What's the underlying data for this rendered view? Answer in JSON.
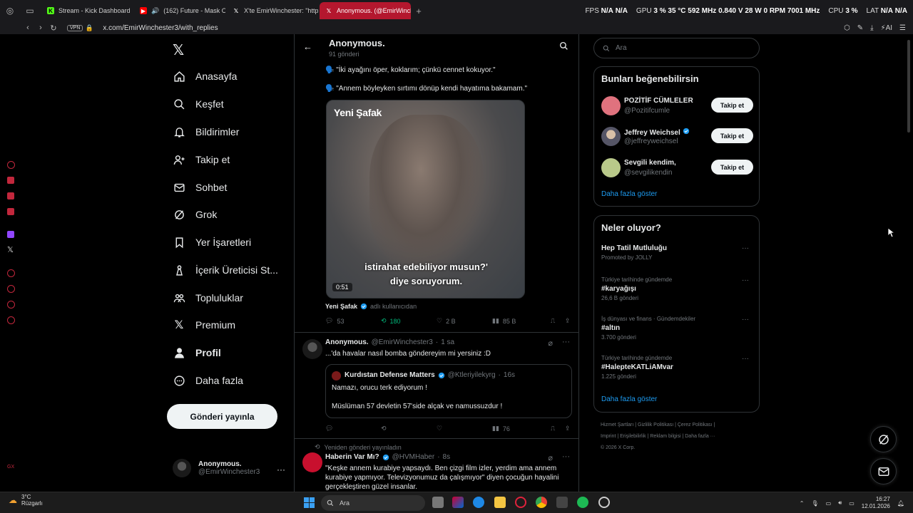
{
  "browser": {
    "tabs": [
      {
        "label": "Stream - Kick Dashboard",
        "active": false
      },
      {
        "label": "(162) Future - Mask Of",
        "active": false
      },
      {
        "label": "X'te EmirWinchester: \"http",
        "active": false
      },
      {
        "label": "Anonymous. (@EmirWinch",
        "active": true
      }
    ],
    "url": "x.com/EmirWinchester3/with_replies",
    "vpn_label": "VPN",
    "hud": {
      "fps_label": "FPS",
      "fps_1": "N/A",
      "fps_2": "N/A",
      "gpu_label": "GPU",
      "gpu_load": "3 %",
      "gpu_temp": "35 °C",
      "gpu_clock": "592 MHz",
      "gpu_voltage": "0.840 V",
      "gpu_power": "28 W",
      "gpu_rpm": "0 RPM",
      "gpu_mem": "7001 MHz",
      "cpu_label": "CPU",
      "cpu_load": "3 %",
      "lat_label": "LAT",
      "lat_1": "N/A",
      "lat_2": "N/A"
    },
    "ai_label": "AI"
  },
  "nav": {
    "items": [
      {
        "label": "Anasayfa",
        "icon": "home-icon"
      },
      {
        "label": "Keşfet",
        "icon": "search-icon"
      },
      {
        "label": "Bildirimler",
        "icon": "bell-icon"
      },
      {
        "label": "Takip et",
        "icon": "follow-icon"
      },
      {
        "label": "Sohbet",
        "icon": "mail-icon"
      },
      {
        "label": "Grok",
        "icon": "grok-icon"
      },
      {
        "label": "Yer İşaretleri",
        "icon": "bookmark-icon"
      },
      {
        "label": "İçerik Üreticisi St...",
        "icon": "creator-icon"
      },
      {
        "label": "Topluluklar",
        "icon": "communities-icon"
      },
      {
        "label": "Premium",
        "icon": "x-icon"
      },
      {
        "label": "Profil",
        "icon": "profile-icon"
      },
      {
        "label": "Daha fazla",
        "icon": "more-icon"
      }
    ],
    "post_button": "Gönderi yayınla",
    "account": {
      "name": "Anonymous.",
      "handle": "@EmirWinchester3"
    }
  },
  "profile_header": {
    "name": "Anonymous.",
    "post_count": "91 gönderi"
  },
  "tweet1": {
    "lines": [
      "🗣️ \"İki ayağını öper, koklarım; çünkü cennet kokuyor.\"",
      "🗣️ \"Annem böyleyken sırtımı dönüp kendi hayatıma bakamam.\""
    ],
    "video_brand": "Yeni Şafak",
    "subtitle_1": "istirahat edebiliyor musun?'",
    "subtitle_2": "diye soruyorum.",
    "duration": "0:51",
    "source_name": "Yeni Şafak",
    "source_suffix": "adlı kullanıcıdan",
    "replies": "53",
    "reposts": "180",
    "likes": "2 B",
    "views": "85 B"
  },
  "tweet2": {
    "name": "Anonymous.",
    "handle": "@EmirWinchester3",
    "time": "1 sa",
    "text": "...'da havalar nasıl bomba göndereyim mi yersiniz :D",
    "quote": {
      "name": "Kurdıstan Defense Matters",
      "handle": "@Ktleriyilekyrg",
      "time": "16s",
      "line1": "Namazı, orucu terk ediyorum !",
      "line2": "Müslüman 57 devletin 57'side alçak ve namussuzdur !"
    },
    "views": "76"
  },
  "tweet3": {
    "repost_label": "Yeniden gönderi yayınladın",
    "name": "Haberin Var Mı?",
    "handle": "@HVMHaber",
    "time": "8s",
    "text": "\"Keşke annem kurabiye yapsaydı. Ben çizgi film izler, yerdim ama annem kurabiye yapmıyor. Televizyonumuz da çalışmıyor\" diyen çocuğun hayalini gerçekleştiren güzel insanlar."
  },
  "right": {
    "search_placeholder": "Ara",
    "suggestions_title": "Bunları beğenebilirsin",
    "suggestions": [
      {
        "name": "POZİTİF CÜMLELER",
        "handle": "@Pozitifcumle",
        "button": "Takip et"
      },
      {
        "name": "Jeffrey Weichsel",
        "handle": "@jeffreyweichsel",
        "button": "Takip et"
      },
      {
        "name": "Sevgili kendim,",
        "handle": "@sevgilikendin",
        "button": "Takip et"
      }
    ],
    "show_more": "Daha fazla göster",
    "trends_title": "Neler oluyor?",
    "trends": [
      {
        "meta": "",
        "name": "Hep Tatil Mutluluğu",
        "count": "Promoted by JOLLY"
      },
      {
        "meta": "Türkiye tarihinde gündemde",
        "name": "#karyağışı",
        "count": "26,6 B gönderi"
      },
      {
        "meta": "İş dünyası ve finans · Gündemdekiler",
        "name": "#altın",
        "count": "3.700 gönderi"
      },
      {
        "meta": "Türkiye tarihinde gündemde",
        "name": "#HalepteKATLiAMvar",
        "count": "1.225 gönderi"
      }
    ],
    "trends_more": "Daha fazla göster",
    "footer_line1": "Hizmet Şartları  |  Gizlilik Politikası  |  Çerez Politikası  |",
    "footer_line2": "Imprint  |  Erişilebilirlik  |  Reklam bilgisi  |  Daha fazla ···",
    "footer_line3": "© 2026 X Corp."
  },
  "taskbar": {
    "temp": "3°C",
    "weather": "Rüzgarlı",
    "search_placeholder": "Ara",
    "time": "16:27",
    "date": "12.01.2026"
  }
}
